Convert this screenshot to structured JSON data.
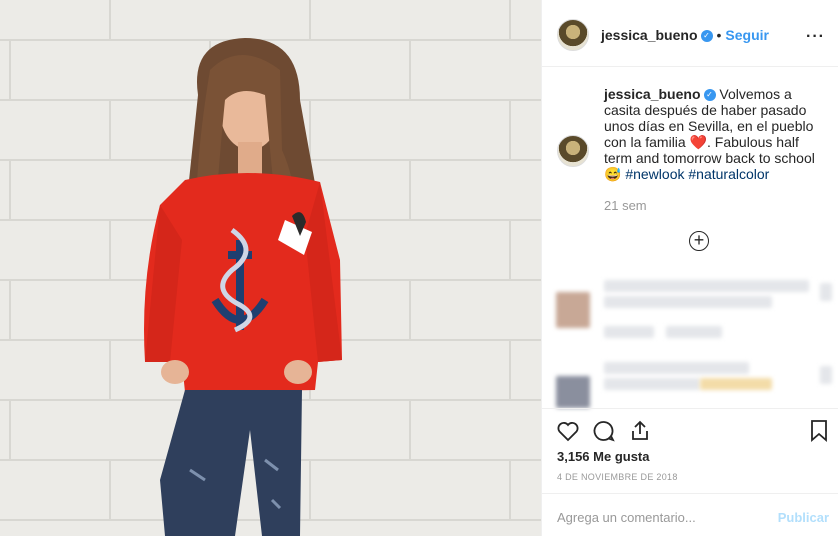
{
  "post": {
    "username": "jessica_bueno",
    "verified_icon": "verified-badge-icon",
    "follow_label": "Seguir",
    "caption_text": "Volvemos a casita después de haber pasado unos días en Sevilla, en el pueblo con la familia",
    "caption_text_2": ". Fabulous half term and tomorrow back to school",
    "hashtag_1": "#newlook",
    "hashtag_2": "#naturalcolor",
    "time_ago": "21 sem",
    "likes": "3,156 Me gusta",
    "date": "4 DE NOVIEMBRE DE 2018",
    "heart_emoji": "❤️",
    "smile_emoji": "😅"
  },
  "comment_box": {
    "placeholder": "Agrega un comentario...",
    "publish_label": "Publicar"
  },
  "colors": {
    "accent": "#3897f0",
    "hashtag": "#003569",
    "sweater": "#e32a1d",
    "muted": "#999999"
  }
}
